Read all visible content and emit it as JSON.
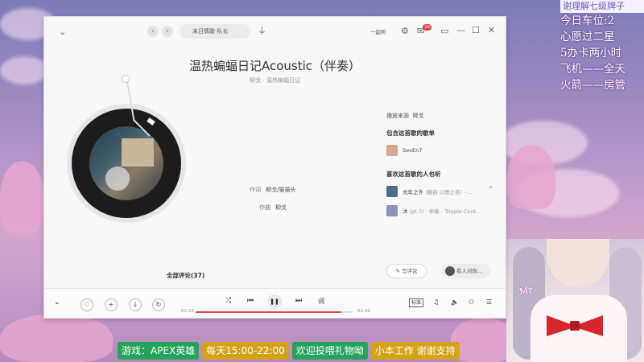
{
  "overlay": {
    "lines": [
      "谢理解七级牌子",
      "今日车位:2",
      "心愿过二星",
      "5办卡两小时",
      "飞机——全天",
      "火箭——房管"
    ]
  },
  "banner": {
    "game": "游戏：APEX英雄",
    "schedule": "每天15:00-22:00",
    "gift": "欢迎投喂礼物呦",
    "support": "小本工作 谢谢支持"
  },
  "cam_tag": "Mr",
  "app": {
    "search_text": "未日情歌-队长",
    "listen_together": "一起听",
    "badge_count": "20",
    "song": {
      "title": "温热蝙蝠日记Acoustic（伴奏）",
      "artist_album": "柳戈 - 温热蝙蝠日记"
    },
    "credits": {
      "lyricist_label": "作词",
      "lyricist": "柳戈/猫猫头",
      "composer_label": "作曲",
      "composer": "柳戈"
    },
    "side": {
      "source_label": "播放来源",
      "source_value": "柳戈",
      "playlists_title": "包含这首歌的歌单",
      "playlist_1": "SevEn7",
      "fans_title": "喜欢这首歌的人也听",
      "rec_1_title": "光年之外",
      "rec_1_sub": "(翻自 以图之名) - ...",
      "rec_2_title": "沐",
      "rec_2_sub": "(pt.7) · 伴奏 - Tripple Cont..."
    },
    "comments_title": "全部评论(37)",
    "write_comment": "写评论",
    "listener_text": "有人对你...",
    "player": {
      "time_current": "02:29",
      "time_total": "02:40",
      "progress": 0.93,
      "lyric_btn": "词",
      "quality": "标准"
    }
  },
  "colors": {
    "accent": "#e04848",
    "banner_green": "#26a35a",
    "banner_gold": "#d4a216"
  }
}
